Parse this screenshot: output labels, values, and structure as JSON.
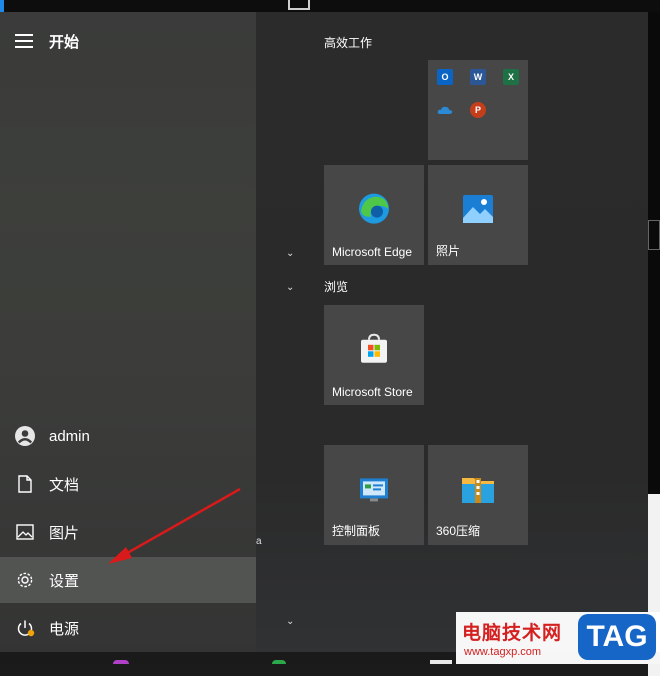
{
  "start_menu": {
    "title": "开始",
    "user": "admin",
    "nav": {
      "documents": "文档",
      "pictures": "图片",
      "settings": "设置",
      "power": "电源"
    }
  },
  "tile_groups": {
    "productivity": {
      "title": "高效工作",
      "office_icons": [
        "outlook-icon",
        "word-icon",
        "excel-icon",
        "onedrive-icon",
        "powerpoint-icon"
      ],
      "edge_label": "Microsoft Edge",
      "photos_label": "照片"
    },
    "browse": {
      "title": "浏览",
      "store_label": "Microsoft Store"
    },
    "third": {
      "control_panel_label": "控制面板",
      "zip_label": "360压缩"
    }
  },
  "stray_text": "a",
  "watermark": {
    "cn_text": "电脑技术网",
    "url": "www.tagxp.com",
    "tag": "TAG"
  },
  "colors": {
    "arrow": "#d91a1a",
    "active_item": "#525452",
    "tile": "#474747",
    "watermark_red": "#d42020",
    "watermark_blue": "#1566c7"
  }
}
